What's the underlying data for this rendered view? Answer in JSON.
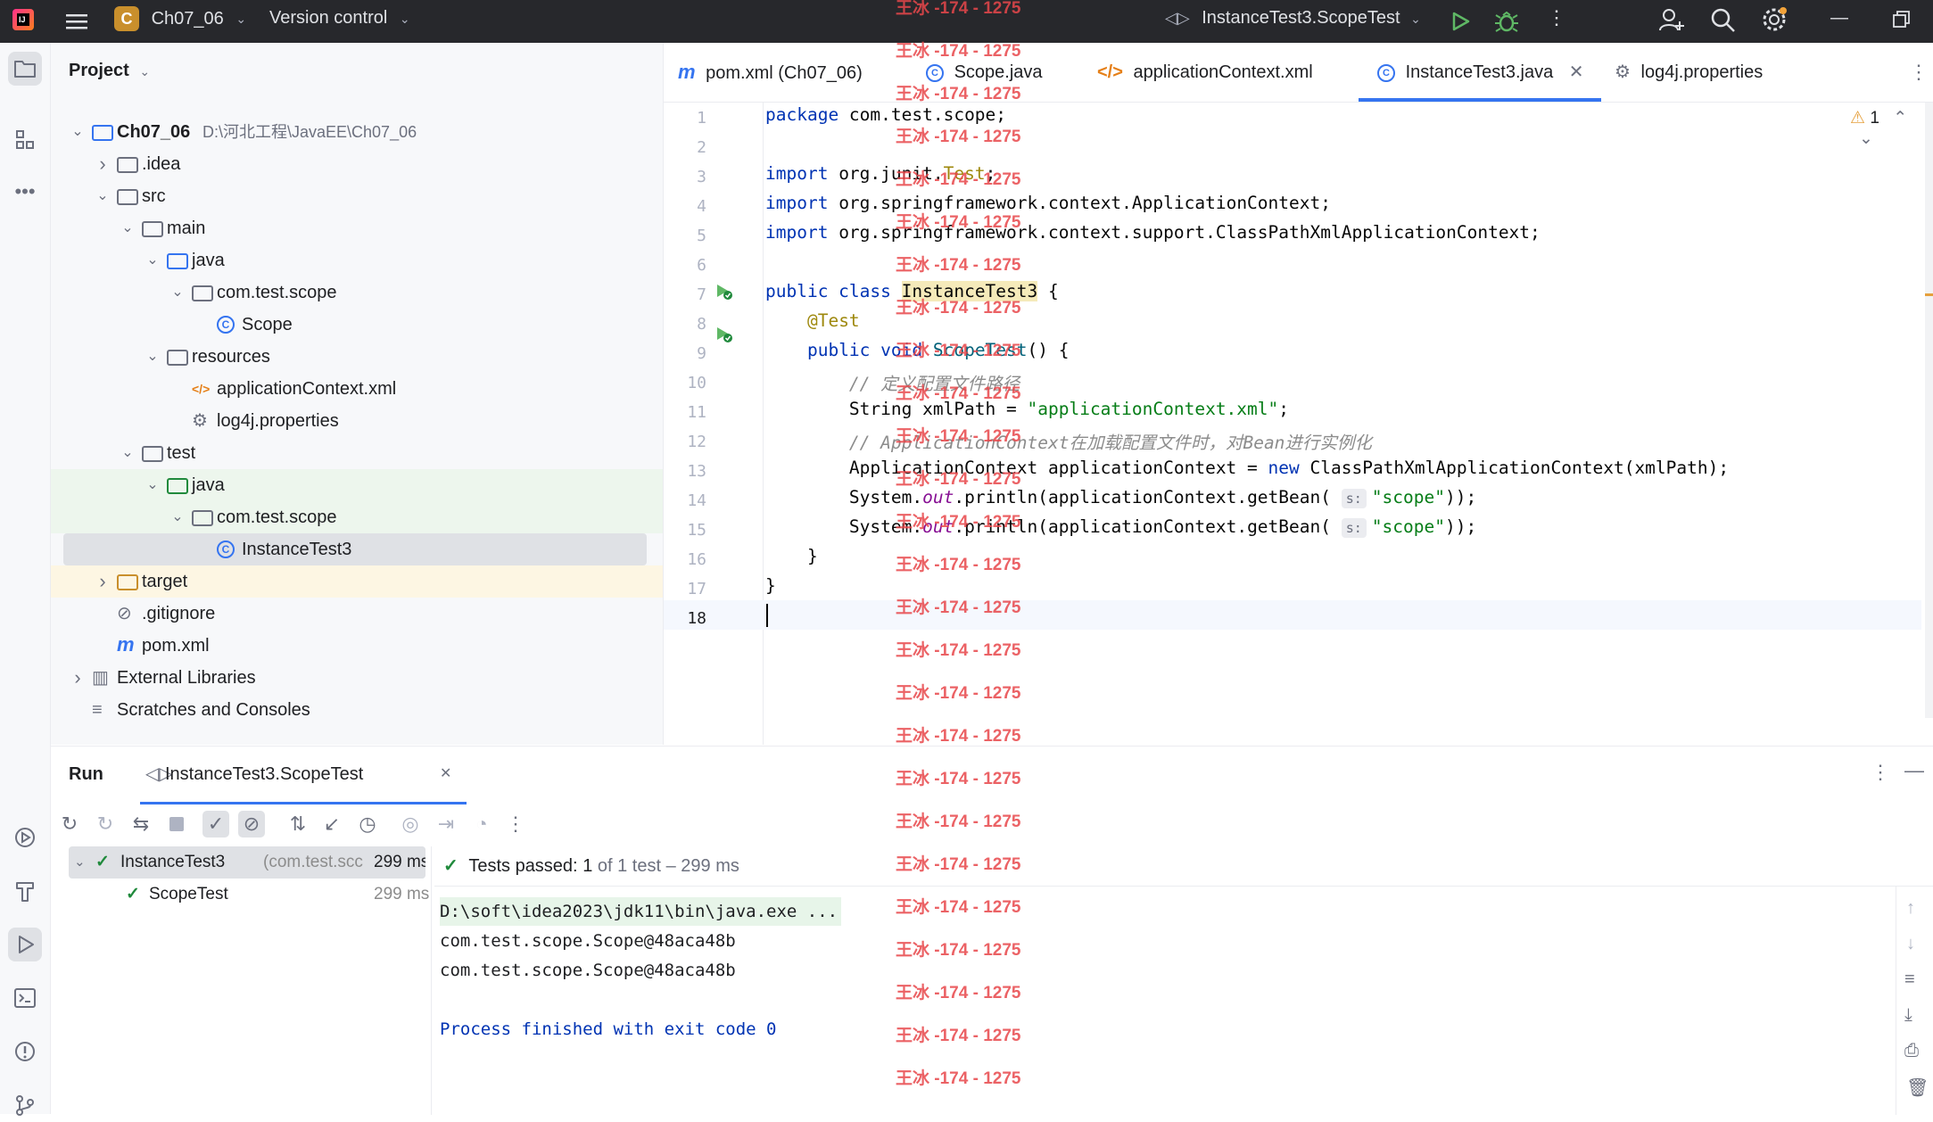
{
  "titlebar": {
    "project_badge": "C",
    "project_name": "Ch07_06",
    "version_control": "Version control",
    "run_config": "InstanceTest3.ScopeTest"
  },
  "project_panel": {
    "title": "Project",
    "tree": [
      {
        "label": "Ch07_06",
        "path": "D:\\河北工程\\JavaEE\\Ch07_06",
        "icon": "module-folder-icon",
        "level": 0,
        "expanded": true
      },
      {
        "label": ".idea",
        "icon": "folder-icon",
        "level": 1,
        "expanded": false
      },
      {
        "label": "src",
        "icon": "folder-icon",
        "level": 1,
        "expanded": true
      },
      {
        "label": "main",
        "icon": "folder-icon",
        "level": 2,
        "expanded": true
      },
      {
        "label": "java",
        "icon": "source-folder-icon",
        "level": 3,
        "expanded": true
      },
      {
        "label": "com.test.scope",
        "icon": "package-icon",
        "level": 4,
        "expanded": true
      },
      {
        "label": "Scope",
        "icon": "class-icon",
        "level": 5
      },
      {
        "label": "resources",
        "icon": "resources-folder-icon",
        "level": 3,
        "expanded": true
      },
      {
        "label": "applicationContext.xml",
        "icon": "xml-file-icon",
        "level": 4
      },
      {
        "label": "log4j.properties",
        "icon": "properties-file-icon",
        "level": 4
      },
      {
        "label": "test",
        "icon": "folder-icon",
        "level": 2,
        "expanded": true
      },
      {
        "label": "java",
        "icon": "test-folder-icon",
        "level": 3,
        "expanded": true
      },
      {
        "label": "com.test.scope",
        "icon": "package-icon",
        "level": 4,
        "expanded": true
      },
      {
        "label": "InstanceTest3",
        "icon": "class-icon",
        "level": 5,
        "selected": true
      },
      {
        "label": "target",
        "icon": "excluded-folder-icon",
        "level": 1,
        "expanded": false
      },
      {
        "label": ".gitignore",
        "icon": "ignore-file-icon",
        "level": 1
      },
      {
        "label": "pom.xml",
        "icon": "maven-icon",
        "level": 1
      },
      {
        "label": "External Libraries",
        "icon": "libraries-icon",
        "level": 0,
        "expanded": false
      },
      {
        "label": "Scratches and Consoles",
        "icon": "scratches-icon",
        "level": 0
      }
    ]
  },
  "editor": {
    "tabs": [
      {
        "label": "pom.xml (Ch07_06)",
        "icon": "maven-icon"
      },
      {
        "label": "Scope.java",
        "icon": "class-icon"
      },
      {
        "label": "applicationContext.xml",
        "icon": "xml-file-icon"
      },
      {
        "label": "InstanceTest3.java",
        "icon": "class-icon",
        "active": true
      },
      {
        "label": "log4j.properties",
        "icon": "properties-file-icon"
      }
    ],
    "warning_count": "1",
    "line_numbers": [
      "1",
      "2",
      "3",
      "4",
      "5",
      "6",
      "7",
      "8",
      "9",
      "10",
      "11",
      "12",
      "13",
      "14",
      "15",
      "16",
      "17",
      "18"
    ]
  },
  "run_panel": {
    "title": "Run",
    "config_tab": "InstanceTest3.ScopeTest",
    "tree": [
      {
        "label": "InstanceTest3",
        "detail": "(com.test.scc",
        "time": "299 ms"
      },
      {
        "label": "ScopeTest",
        "time": "299 ms"
      }
    ],
    "status_bold": "Tests passed:",
    "status_count": "1",
    "status_rest": "of 1 test – 299 ms",
    "console": [
      "D:\\soft\\idea2023\\jdk11\\bin\\java.exe ...",
      "com.test.scope.Scope@48aca48b",
      "com.test.scope.Scope@48aca48b",
      "",
      "Process finished with exit code 0"
    ]
  },
  "watermark": "王冰 -174 - 1275",
  "colors": {
    "titlebar_bg": "#27282c",
    "accent": "#3574f0",
    "keyword": "#0033b3",
    "string": "#067d17",
    "watermark": "#e8474b"
  }
}
